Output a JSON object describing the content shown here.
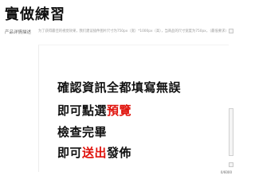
{
  "page": {
    "title": "實做練習"
  },
  "form": {
    "description_label": "产品详情描述",
    "hint": "为了获得最佳的视觉效果，我们建议插件图片尺寸为750px（宽）*1000px（高），当商品的尺寸宽度为750px，（最低要求）将按原比例缩放"
  },
  "editor": {
    "lines": [
      {
        "prefix": "確認資訊全都填寫無誤",
        "highlight": "",
        "suffix": ""
      },
      {
        "prefix": "即可點選",
        "highlight": "預覽",
        "suffix": ""
      },
      {
        "prefix": "檢查完畢",
        "highlight": "",
        "suffix": ""
      },
      {
        "prefix": "即可",
        "highlight": "送出",
        "suffix": "發佈"
      }
    ],
    "char_count": "0/6000"
  },
  "colors": {
    "highlight": "#e0120b",
    "text": "#111111"
  }
}
